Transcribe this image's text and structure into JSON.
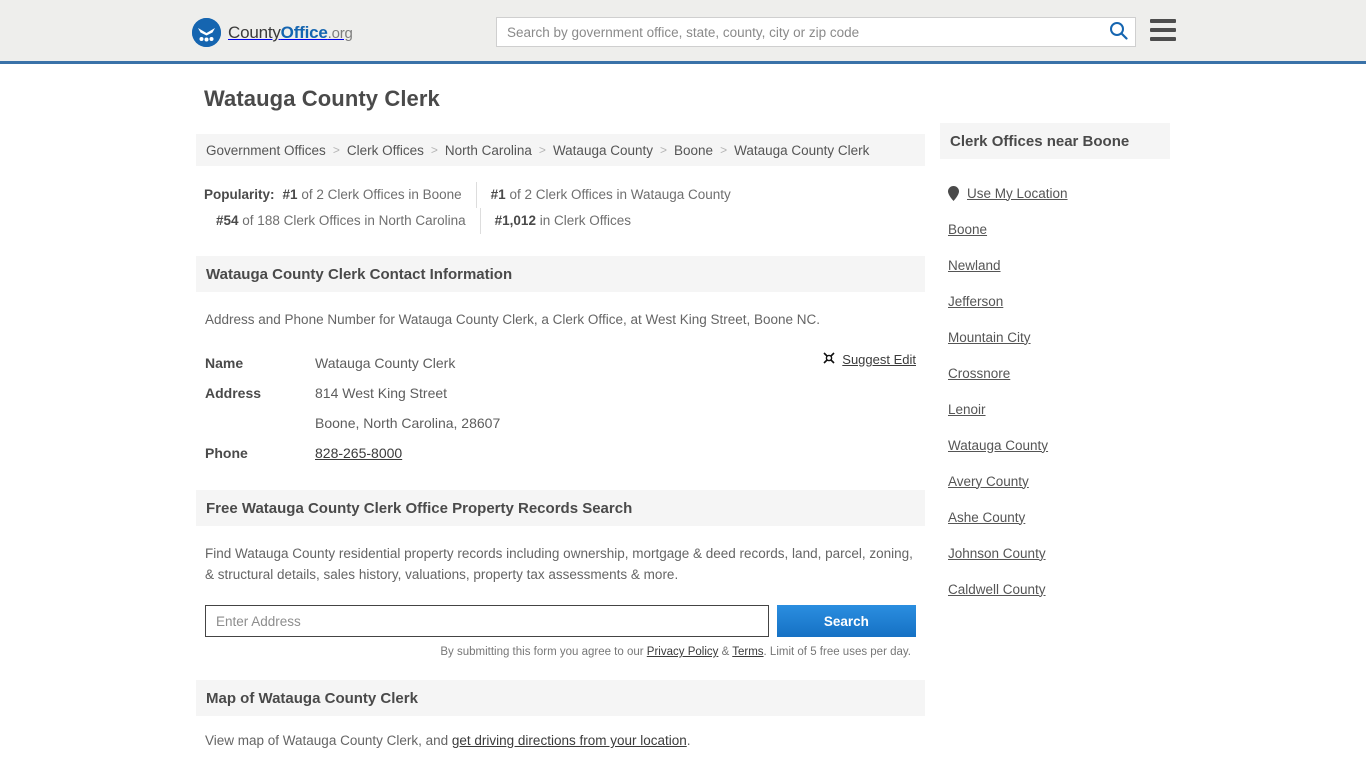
{
  "header": {
    "logo": {
      "part1": "County",
      "part2": "Office",
      "part3": ".org",
      "mark_icon": "eagle-stars-emblem"
    },
    "search": {
      "placeholder": "Search by government office, state, county, city or zip code",
      "value": "",
      "icon": "search-icon"
    },
    "menu_icon": "hamburger-menu-icon",
    "accent_color": "#3a72a8"
  },
  "main": {
    "page_title": "Watauga County Clerk",
    "breadcrumb": {
      "separator": ">",
      "items": [
        "Government Offices",
        "Clerk Offices",
        "North Carolina",
        "Watauga County",
        "Boone",
        "Watauga County Clerk"
      ]
    },
    "popularity": {
      "label": "Popularity:",
      "stat1": {
        "rank": "#1",
        "text": "of 2 Clerk Offices in Boone"
      },
      "stat2": {
        "rank": "#1",
        "text": "of 2 Clerk Offices in Watauga County"
      },
      "stat3": {
        "rank": "#54",
        "text": "of 188 Clerk Offices in North Carolina"
      },
      "stat4": {
        "rank": "#1,012",
        "text": "in Clerk Offices"
      }
    },
    "contact_section": {
      "heading": "Watauga County Clerk Contact Information",
      "intro": "Address and Phone Number for Watauga County Clerk, a Clerk Office, at West King Street, Boone NC.",
      "rows": [
        {
          "key": "Name",
          "value": "Watauga County Clerk"
        },
        {
          "key": "Address",
          "value": "814 West King Street"
        },
        {
          "key": "",
          "value": "Boone, North Carolina, 28607"
        },
        {
          "key": "Phone",
          "value": "828-265-8000"
        }
      ],
      "suggest_edit": {
        "label": "Suggest Edit",
        "icon": "edit-pencil-icon"
      }
    },
    "records_section": {
      "heading": "Free Watauga County Clerk Office Property Records Search",
      "intro": "Find Watauga County residential property records including ownership, mortgage & deed records, land, parcel, zoning, & structural details, sales history, valuations, property tax assessments & more.",
      "input_placeholder": "Enter Address",
      "input_value": "",
      "button_label": "Search",
      "button_color": "#1571c4",
      "fineprint": {
        "pre": "By submitting this form you agree to our ",
        "link1": "Privacy Policy",
        "mid": " & ",
        "link2": "Terms",
        "post": ". Limit of 5 free uses per day."
      }
    },
    "map_section": {
      "heading": "Map of Watauga County Clerk",
      "intro_pre": "View map of Watauga County Clerk, and ",
      "intro_link": "get driving directions from your location",
      "intro_post": "."
    }
  },
  "sidebar": {
    "heading": "Clerk Offices near Boone",
    "use_my_location": {
      "label": "Use My Location",
      "icon": "map-pin-icon"
    },
    "items": [
      "Boone",
      "Newland",
      "Jefferson",
      "Mountain City",
      "Crossnore",
      "Lenoir",
      "Watauga County",
      "Avery County",
      "Ashe County",
      "Johnson County",
      "Caldwell County"
    ]
  }
}
